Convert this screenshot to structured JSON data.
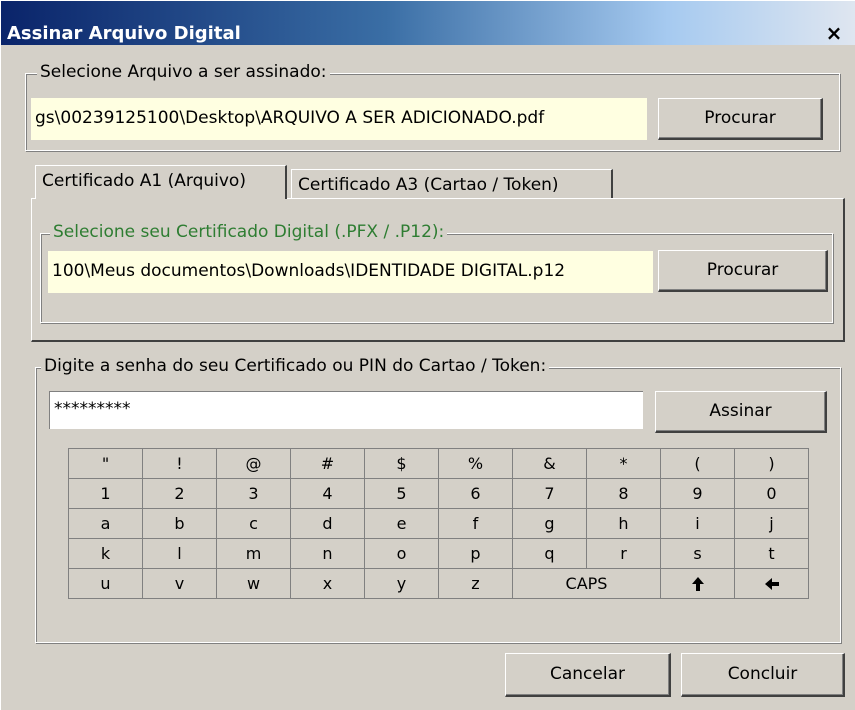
{
  "window": {
    "title": "Assinar Arquivo Digital",
    "close_label": "×"
  },
  "file_group": {
    "legend": "Selecione Arquivo a ser assinado:",
    "path_value": "gs\\00239125100\\Desktop\\ARQUIVO A SER ADICIONADO.pdf",
    "browse_label": "Procurar"
  },
  "tabs": [
    {
      "label": "Certificado A1 (Arquivo)",
      "active": true
    },
    {
      "label": "Certificado A3 (Cartao / Token)",
      "active": false
    }
  ],
  "cert_group": {
    "legend": "Selecione seu Certificado Digital (.PFX / .P12):",
    "legend_color": "#2e7d32",
    "path_value": "100\\Meus documentos\\Downloads\\IDENTIDADE DIGITAL.p12",
    "browse_label": "Procurar"
  },
  "password_group": {
    "legend": "Digite a senha do seu Certificado ou PIN do Cartao / Token:",
    "password_value": "*********",
    "sign_label": "Assinar"
  },
  "keyboard": {
    "rows": [
      [
        "\"",
        "!",
        "@",
        "#",
        "$",
        "%",
        "&",
        "*",
        "(",
        ")"
      ],
      [
        "1",
        "2",
        "3",
        "4",
        "5",
        "6",
        "7",
        "8",
        "9",
        "0"
      ],
      [
        "a",
        "b",
        "c",
        "d",
        "e",
        "f",
        "g",
        "h",
        "i",
        "j"
      ],
      [
        "k",
        "l",
        "m",
        "n",
        "o",
        "p",
        "q",
        "r",
        "s",
        "t"
      ],
      [
        "u",
        "v",
        "w",
        "x",
        "y",
        "z",
        "CAPS",
        "🠕",
        "🠔"
      ]
    ],
    "caps_label": "CAPS",
    "up_arrow": "🠕",
    "backspace_arrow": "🠔"
  },
  "footer": {
    "cancel_label": "Cancelar",
    "finish_label": "Concluir"
  },
  "colors": {
    "face": "#d4d0c8",
    "title_start": "#0a246a",
    "field_bg": "#ffffe1"
  }
}
